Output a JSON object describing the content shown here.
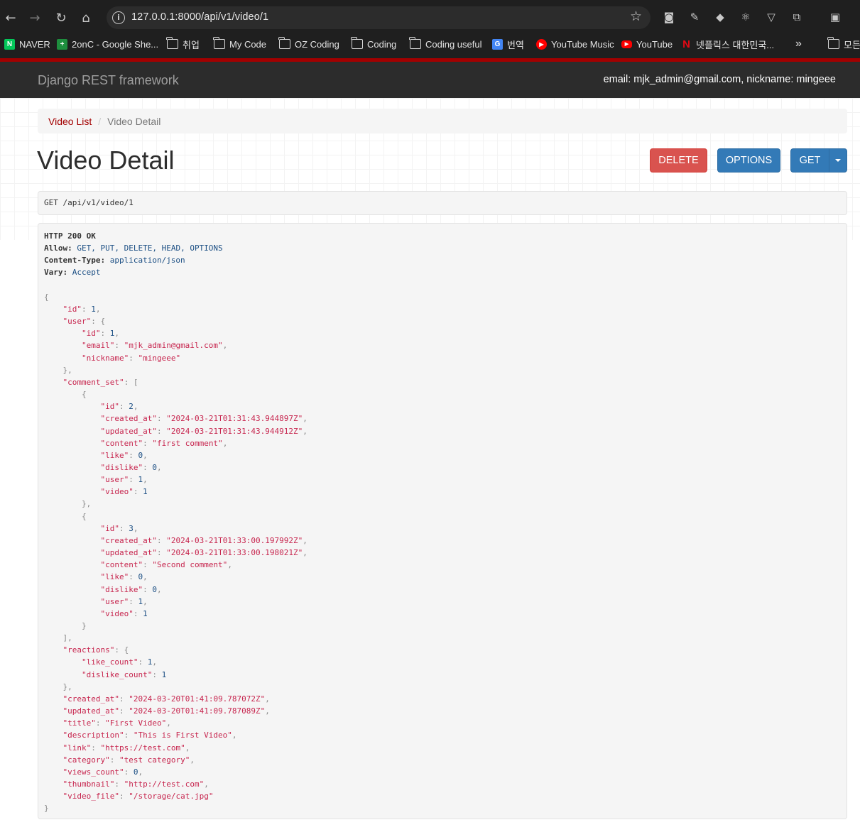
{
  "browser": {
    "url": "127.0.0.1:8000/api/v1/video/1",
    "bookmarks": [
      {
        "label": "NAVER",
        "icon": "naver-icon"
      },
      {
        "label": "2onC - Google She...",
        "icon": "sheets-icon"
      },
      {
        "label": "취업",
        "icon": "folder-icon"
      },
      {
        "label": "My Code",
        "icon": "folder-icon"
      },
      {
        "label": "OZ Coding",
        "icon": "folder-icon"
      },
      {
        "label": "Coding",
        "icon": "folder-icon"
      },
      {
        "label": "Coding useful",
        "icon": "folder-icon"
      },
      {
        "label": "번역",
        "icon": "translate-icon"
      },
      {
        "label": "YouTube Music",
        "icon": "youtube-music-icon"
      },
      {
        "label": "YouTube",
        "icon": "youtube-icon"
      },
      {
        "label": "넷플릭스 대한민국...",
        "icon": "netflix-icon"
      }
    ],
    "more_label": "»",
    "all_bookmarks_label": "모든"
  },
  "navbar": {
    "brand": "Django REST framework",
    "user_info": "email: mjk_admin@gmail.com, nickname: mingeee"
  },
  "breadcrumb": {
    "parent": "Video List",
    "separator": "/",
    "current": "Video Detail"
  },
  "page": {
    "title": "Video Detail",
    "buttons": {
      "delete": "DELETE",
      "options": "OPTIONS",
      "get": "GET"
    }
  },
  "request": {
    "method": "GET",
    "path": "/api/v1/video/1"
  },
  "response": {
    "status": "HTTP 200 OK",
    "headers": [
      {
        "name": "Allow:",
        "value": "GET, PUT, DELETE, HEAD, OPTIONS"
      },
      {
        "name": "Content-Type:",
        "value": "application/json"
      },
      {
        "name": "Vary:",
        "value": "Accept"
      }
    ],
    "body": {
      "id": 1,
      "user": {
        "id": 1,
        "email": "mjk_admin@gmail.com",
        "nickname": "mingeee"
      },
      "comment_set": [
        {
          "id": 2,
          "created_at": "2024-03-21T01:31:43.944897Z",
          "updated_at": "2024-03-21T01:31:43.944912Z",
          "content": "first comment",
          "like": 0,
          "dislike": 0,
          "user": 1,
          "video": 1
        },
        {
          "id": 3,
          "created_at": "2024-03-21T01:33:00.197992Z",
          "updated_at": "2024-03-21T01:33:00.198021Z",
          "content": "Second comment",
          "like": 0,
          "dislike": 0,
          "user": 1,
          "video": 1
        }
      ],
      "reactions": {
        "like_count": 1,
        "dislike_count": 1
      },
      "created_at": "2024-03-20T01:41:09.787072Z",
      "updated_at": "2024-03-20T01:41:09.787089Z",
      "title": "First Video",
      "description": "This is First Video",
      "link": "https://test.com",
      "category": "test category",
      "views_count": 0,
      "thumbnail": "http://test.com",
      "video_file": "/storage/cat.jpg"
    }
  }
}
